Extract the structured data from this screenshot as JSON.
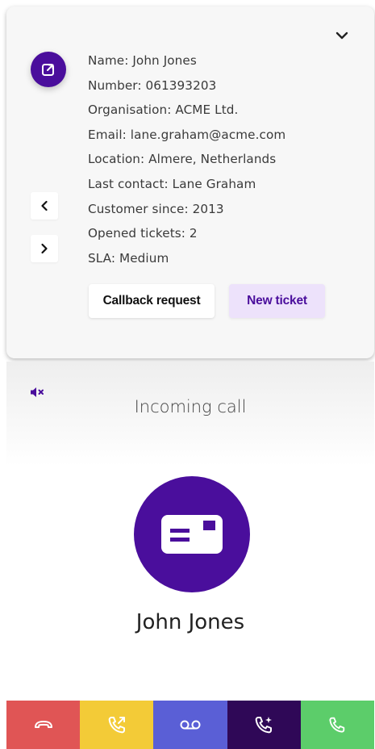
{
  "contact": {
    "rows": [
      "Name: John Jones",
      "Number: 061393203",
      "Organisation: ACME Ltd.",
      "Email: lane.graham@acme.com",
      "Location: Almere, Netherlands",
      "Last contact:  Lane Graham",
      "Customer since: 2013",
      "Opened tickets: 2",
      "SLA: Medium"
    ]
  },
  "actions": {
    "callback_label": "Callback request",
    "new_ticket_label": "New ticket"
  },
  "call": {
    "status": "Incoming call",
    "caller_name": "John Jones"
  },
  "icons": {
    "collapse": "chevron-down-icon",
    "open_contact": "external-link-icon",
    "prev": "chevron-left-icon",
    "next": "chevron-right-icon",
    "mute": "speaker-mute-icon",
    "caller": "contact-card-icon",
    "decline": "hang-up-icon",
    "forward": "forward-call-icon",
    "voicemail": "voicemail-icon",
    "assist": "ai-call-icon",
    "accept": "phone-icon"
  },
  "colors": {
    "brand": "#4a0e9c",
    "ticket_bg": "#ede2fb",
    "decline": "#e05555",
    "forward": "#f3cb37",
    "voicemail": "#5a5fd6",
    "assist": "#2f0857",
    "accept": "#5ccd6a"
  }
}
